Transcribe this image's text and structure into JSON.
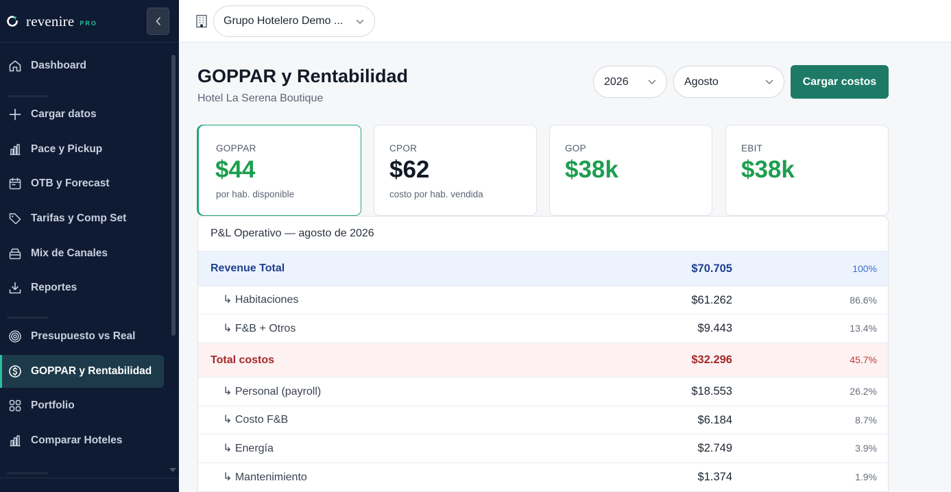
{
  "brand": {
    "name": "revenire",
    "tier": "PRO"
  },
  "sidebar": {
    "items": [
      {
        "label": "Dashboard"
      },
      {
        "label": "Cargar datos"
      },
      {
        "label": "Pace y Pickup"
      },
      {
        "label": "OTB y Forecast"
      },
      {
        "label": "Tarifas y Comp Set"
      },
      {
        "label": "Mix de Canales"
      },
      {
        "label": "Reportes"
      },
      {
        "label": "Presupuesto vs Real"
      },
      {
        "label": "GOPPAR y Rentabilidad",
        "active": true
      },
      {
        "label": "Portfolio"
      },
      {
        "label": "Comparar Hoteles"
      }
    ]
  },
  "topbar": {
    "group_select": "Grupo Hotelero Demo ..."
  },
  "header": {
    "title": "GOPPAR y Rentabilidad",
    "subtitle": "Hotel La Serena Boutique",
    "year": "2026",
    "month": "Agosto",
    "cta": "Cargar costos"
  },
  "kpis": [
    {
      "label": "GOPPAR",
      "value": "$44",
      "sub": "por hab. disponible"
    },
    {
      "label": "CPOR",
      "value": "$62",
      "sub": "costo por hab. vendida"
    },
    {
      "label": "GOP",
      "value": "$38k",
      "sub": ""
    },
    {
      "label": "EBIT",
      "value": "$38k",
      "sub": ""
    }
  ],
  "pl": {
    "title": "P&L Operativo — agosto de 2026",
    "rows": [
      {
        "name": "Revenue Total",
        "amount": "$70.705",
        "pct": "100%"
      },
      {
        "name": "↳ Habitaciones",
        "amount": "$61.262",
        "pct": "86.6%"
      },
      {
        "name": "↳ F&B + Otros",
        "amount": "$9.443",
        "pct": "13.4%"
      },
      {
        "name": "Total costos",
        "amount": "$32.296",
        "pct": "45.7%"
      },
      {
        "name": "↳ Personal (payroll)",
        "amount": "$18.553",
        "pct": "26.2%"
      },
      {
        "name": "↳ Costo F&B",
        "amount": "$6.184",
        "pct": "8.7%"
      },
      {
        "name": "↳ Energía",
        "amount": "$2.749",
        "pct": "3.9%"
      },
      {
        "name": "↳ Mantenimiento",
        "amount": "$1.374",
        "pct": "1.9%"
      }
    ]
  }
}
